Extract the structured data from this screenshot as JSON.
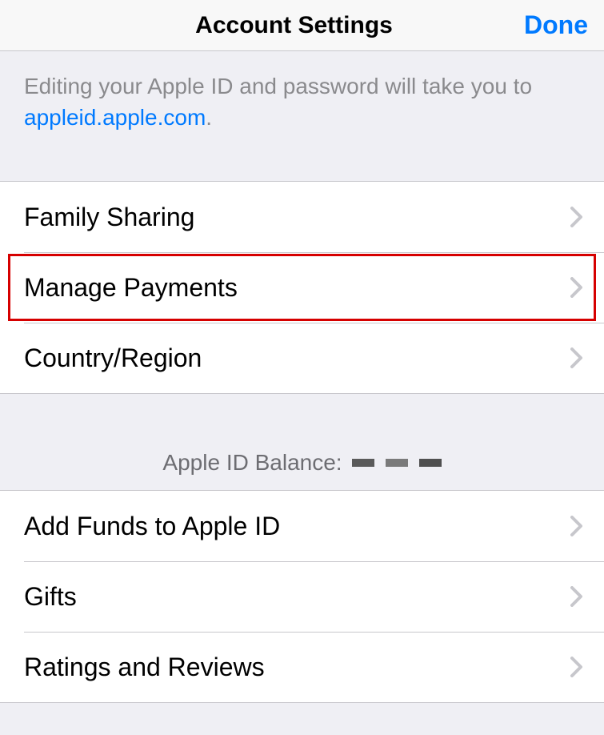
{
  "header": {
    "title": "Account Settings",
    "done_label": "Done"
  },
  "info": {
    "text_prefix": "Editing your Apple ID and password will take you to ",
    "link_text": "appleid.apple.com",
    "text_suffix": "."
  },
  "section1": {
    "items": [
      {
        "label": "Family Sharing"
      },
      {
        "label": "Manage Payments"
      },
      {
        "label": "Country/Region"
      }
    ]
  },
  "balance": {
    "label": "Apple ID Balance:"
  },
  "section2": {
    "items": [
      {
        "label": "Add Funds to Apple ID"
      },
      {
        "label": "Gifts"
      },
      {
        "label": "Ratings and Reviews"
      }
    ]
  }
}
